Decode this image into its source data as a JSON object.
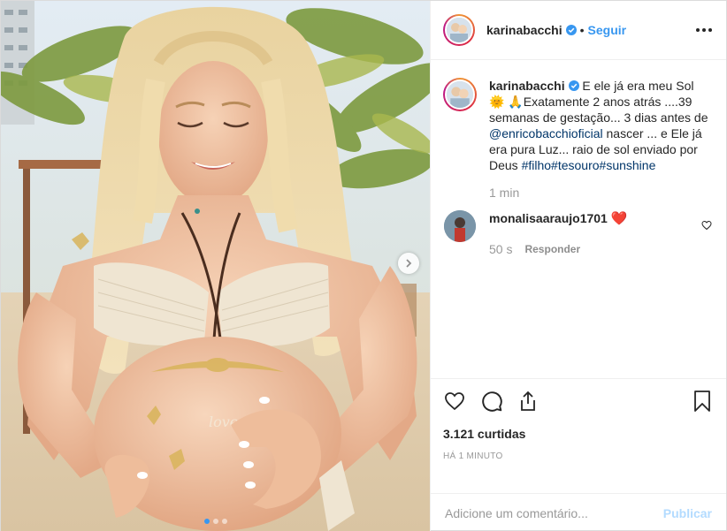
{
  "post": {
    "image_alt": "",
    "carousel": {
      "dots": 3,
      "active": 0
    }
  },
  "header": {
    "username": "karinabacchi",
    "separator": "•",
    "follow_label": "Seguir"
  },
  "caption": {
    "username": "karinabacchi",
    "text_part1": "E ele já era meu Sol",
    "sun_emoji": "🌞",
    "pray_emoji": "🙏",
    "text_part2": "Exatamente 2 anos atrás ....39 semanas de gestação... 3 dias antes de",
    "mention": "@enricobacchioficial",
    "text_part3": "nascer ... e Ele já era pura Luz... raio de sol enviado por Deus",
    "hashtags": "#filho#tesouro#sunshine",
    "time": "1 min"
  },
  "comment": {
    "username": "monalisaaraujo1701",
    "emoji": "❤️",
    "time": "50 s",
    "reply_label": "Responder"
  },
  "actions": {
    "likes_text": "3.121 curtidas",
    "timestamp": "HÁ 1 MINUTO"
  },
  "add_comment": {
    "placeholder": "Adicione um comentário...",
    "publish_label": "Publicar"
  },
  "colors": {
    "link": "#3897f0",
    "text": "#262626",
    "muted": "#999999",
    "publish_disabled": "#b3dbff"
  }
}
